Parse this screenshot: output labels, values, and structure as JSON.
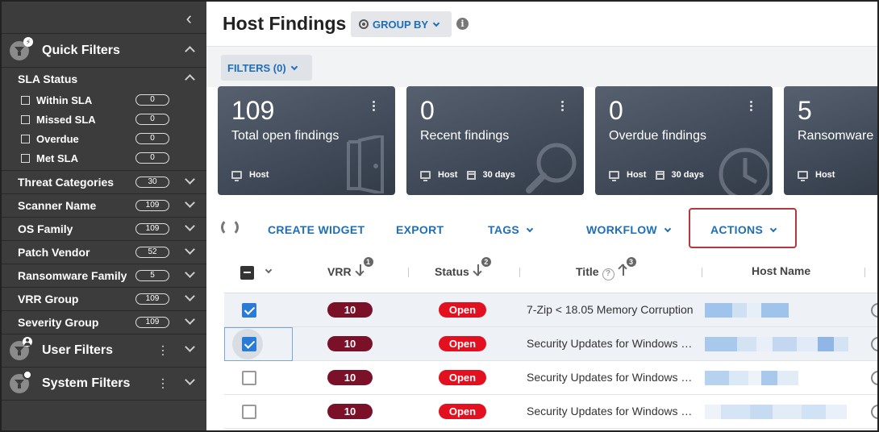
{
  "sidebar": {
    "quick_filters_label": "Quick Filters",
    "sla_status_label": "SLA Status",
    "sla_items": [
      {
        "label": "Within SLA",
        "count": "0"
      },
      {
        "label": "Missed SLA",
        "count": "0"
      },
      {
        "label": "Overdue",
        "count": "0"
      },
      {
        "label": "Met SLA",
        "count": "0"
      }
    ],
    "categories": [
      {
        "label": "Threat Categories",
        "count": "30"
      },
      {
        "label": "Scanner Name",
        "count": "109"
      },
      {
        "label": "OS Family",
        "count": "109"
      },
      {
        "label": "Patch Vendor",
        "count": "52"
      },
      {
        "label": "Ransomware Family",
        "count": "5"
      },
      {
        "label": "VRR Group",
        "count": "109"
      },
      {
        "label": "Severity Group",
        "count": "109"
      }
    ],
    "user_filters_label": "User Filters",
    "system_filters_label": "System Filters"
  },
  "header": {
    "title": "Host Findings",
    "group_by_label": "GROUP BY",
    "filters_label": "FILTERS (0)"
  },
  "cards": [
    {
      "value": "109",
      "label": "Total open findings",
      "asset": "Host",
      "period": ""
    },
    {
      "value": "0",
      "label": "Recent findings",
      "asset": "Host",
      "period": "30 days"
    },
    {
      "value": "0",
      "label": "Overdue findings",
      "asset": "Host",
      "period": "30 days"
    },
    {
      "value": "5",
      "label": "Ransomware",
      "asset": "Host",
      "period": ""
    }
  ],
  "toolbar": {
    "create_widget": "CREATE WIDGET",
    "export": "EXPORT",
    "tags": "TAGS",
    "workflow": "WORKFLOW",
    "actions": "ACTIONS"
  },
  "table": {
    "columns": {
      "vrr": "VRR",
      "vrr_sort": "1",
      "status": "Status",
      "status_sort": "2",
      "title": "Title",
      "title_sort": "3",
      "host": "Host Name"
    },
    "rows": [
      {
        "checked": true,
        "vrr": "10",
        "status": "Open",
        "title": "7-Zip < 18.05 Memory Corruption"
      },
      {
        "checked": true,
        "vrr": "10",
        "status": "Open",
        "title": "Security Updates for Windows Server"
      },
      {
        "checked": false,
        "vrr": "10",
        "status": "Open",
        "title": "Security Updates for Windows Server"
      },
      {
        "checked": false,
        "vrr": "10",
        "status": "Open",
        "title": "Security Updates for Windows Server"
      }
    ]
  },
  "colors": {
    "sidebar_bg": "#3c3c3c",
    "accent_blue": "#1e6fb8",
    "vrr_badge": "#7a1128",
    "status_open": "#e3101f",
    "highlight_border": "#b5373e"
  }
}
